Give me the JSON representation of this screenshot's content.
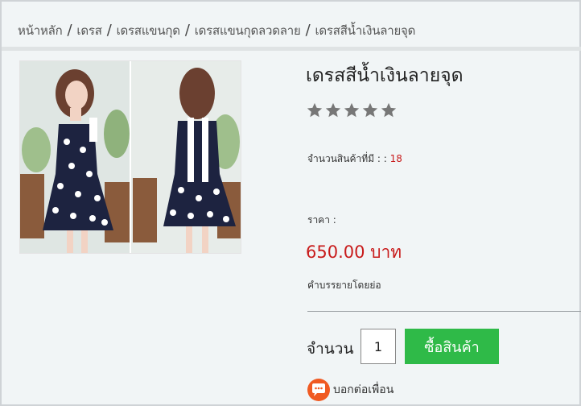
{
  "breadcrumb": {
    "items": [
      "หน้าหลัก",
      "เดรส",
      "เดรสแขนกุด",
      "เดรสแขนกุดลวดลาย",
      "เดรสสีน้ำเงินลายจุด"
    ],
    "separator": "/"
  },
  "product": {
    "title": "เดรสสีน้ำเงินลายจุด",
    "rating": 0,
    "rating_max": 5,
    "stock_label": "จำนวนสินค้าที่มี : :",
    "stock_value": "18",
    "price_label": "ราคา :",
    "price": "650.00 บาท",
    "description_label": "คำบรรยายโดยย่อ"
  },
  "purchase": {
    "qty_label": "จำนวน",
    "qty_value": "1",
    "buy_label": "ซื้อสินค้า"
  },
  "share": {
    "label": "บอกต่อเพื่อน"
  },
  "colors": {
    "price": "#c81b1b",
    "buy_button": "#2fba48",
    "share_icon": "#f05a22",
    "star": "#777777"
  }
}
